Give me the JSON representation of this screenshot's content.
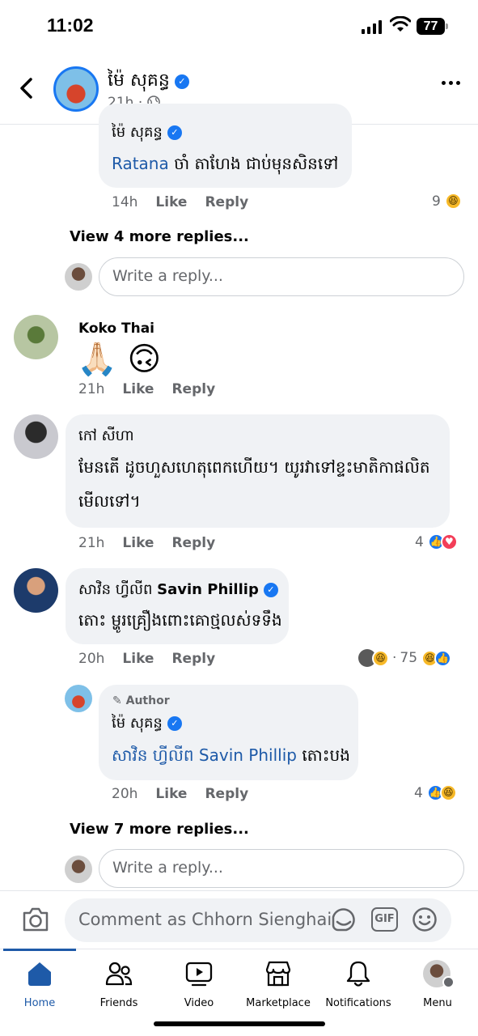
{
  "status_bar": {
    "time": "11:02",
    "battery": "77"
  },
  "header": {
    "name": "ម៉ៃ សុគន្ធ",
    "time": "21h",
    "dot": "·"
  },
  "thread1": {
    "reply": {
      "name": "ម៉ៃ សុគន្ធ",
      "tag": "Ratana",
      "text": " ចាំ តាហែង ជាប់មុនសិនទៅ",
      "time": "14h",
      "like": "Like",
      "reply": "Reply",
      "count": "9"
    },
    "view_more": "View 4 more replies...",
    "reply_placeholder": "Write a reply..."
  },
  "comments": [
    {
      "name": "Koko Thai",
      "text": "🙏🏻 🙃",
      "time": "21h",
      "like": "Like",
      "reply": "Reply"
    },
    {
      "name": "កៅ សីហា",
      "text": "មែនតើ ដូចហួសហេតុពេកហើយ។ យូរវាទៅខ្ទះមាតិកាផលិត មើលទៅ។",
      "time": "21h",
      "like": "Like",
      "reply": "Reply",
      "count": "4"
    },
    {
      "name_km": "សាវិន ហ្វីលីព",
      "name_en": "Savin Phillip",
      "text": "តោះ ម្ហូរគ្រឿងពោះគោថ្មលស់ទទឹង",
      "time": "20h",
      "like": "Like",
      "reply": "Reply",
      "count_prefix": "·",
      "count": "75"
    }
  ],
  "thread3": {
    "reply": {
      "author_label": "Author",
      "name": "ម៉ៃ សុគន្ធ",
      "tag": "សាវិន ហ្វីលីព Savin Phillip",
      "text": " តោះបង",
      "time": "20h",
      "like": "Like",
      "reply": "Reply",
      "count": "4"
    },
    "view_more": "View 7 more replies...",
    "reply_placeholder": "Write a reply..."
  },
  "composer": {
    "placeholder": "Comment as Chhorn Sienghai",
    "gif": "GIF"
  },
  "tabs": [
    {
      "label": "Home",
      "icon": "home-icon",
      "active": true
    },
    {
      "label": "Friends",
      "icon": "friends-icon"
    },
    {
      "label": "Video",
      "icon": "video-icon"
    },
    {
      "label": "Marketplace",
      "icon": "marketplace-icon"
    },
    {
      "label": "Notifications",
      "icon": "bell-icon"
    },
    {
      "label": "Menu",
      "icon": "profile-menu-icon"
    }
  ],
  "colors": {
    "accent": "#1877f2",
    "link": "#1e5aa8",
    "bubble": "#f0f2f5",
    "muted": "#65676b"
  }
}
